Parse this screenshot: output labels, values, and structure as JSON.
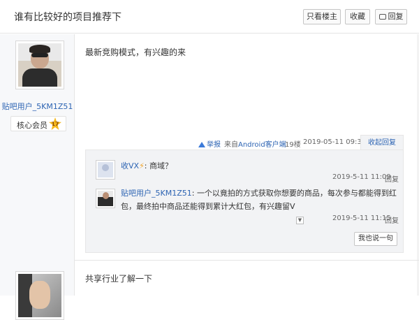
{
  "header": {
    "title": "谁有比较好的项目推荐下",
    "only_owner": "只看楼主",
    "favorite": "收藏",
    "reply": "回复"
  },
  "post1": {
    "username": "贴吧用户_5KM1Z51",
    "badge": "核心会员",
    "level": "17",
    "content": "最新竞购模式，有兴趣的来",
    "report": "举报",
    "source_prefix": "来自",
    "source_link": "Android客户端",
    "floor": "19楼",
    "time": "2019-05-11 09:34",
    "collapse": "收起回复"
  },
  "comments": [
    {
      "name": "收VX",
      "icon": "lightning-icon",
      "bolt": "⚡",
      "sep": ": ",
      "text": "商域？",
      "time": "2019-5-11 11:09",
      "reply": "回复"
    },
    {
      "name": "贴吧用户_5KM1Z51",
      "sep": ": ",
      "text": "一个以竟拍的方式获取你想要的商品，每次参与都能得到红包，最终拍中商品还能得到累计大红包，有兴趣留V",
      "time": "2019-5-11 11:15",
      "reply": "回复"
    }
  ],
  "say_button": "我也说一句",
  "post2": {
    "content": "共享行业了解一下"
  },
  "colors": {
    "link": "#2d64b3",
    "badge_star": "#f5b81c"
  }
}
